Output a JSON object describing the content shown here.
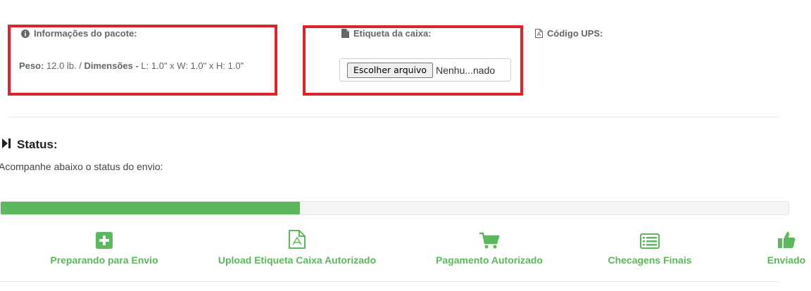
{
  "package": {
    "title": "Informações do pacote:",
    "weight_label": "Peso:",
    "weight_value": " 12.0 lb. / ",
    "dimensions_label": "Dimensões -",
    "dimensions_value": " L: 1.0\" x W: 1.0\" x H: 1.0\""
  },
  "label": {
    "title": "Etiqueta da caixa:",
    "choose_file": "Escolher arquivo",
    "file_status": "Nenhu...nado"
  },
  "ups": {
    "title": "Código UPS:"
  },
  "status": {
    "title": "Status:",
    "subtitle": "Acompanhe abaixo o status do envio:",
    "progress": 0.38
  },
  "steps": [
    {
      "label": "Preparando para Envio",
      "icon": "plus-square-icon"
    },
    {
      "label": "Upload Etiqueta Caixa Autorizado",
      "icon": "pdf-file-icon"
    },
    {
      "label": "Pagamento Autorizado",
      "icon": "cart-icon"
    },
    {
      "label": "Checagens Finais",
      "icon": "list-icon"
    },
    {
      "label": "Enviado",
      "icon": "thumbs-up-icon"
    }
  ],
  "colors": {
    "highlight_border": "#e0232b",
    "success": "#5cb85c"
  }
}
